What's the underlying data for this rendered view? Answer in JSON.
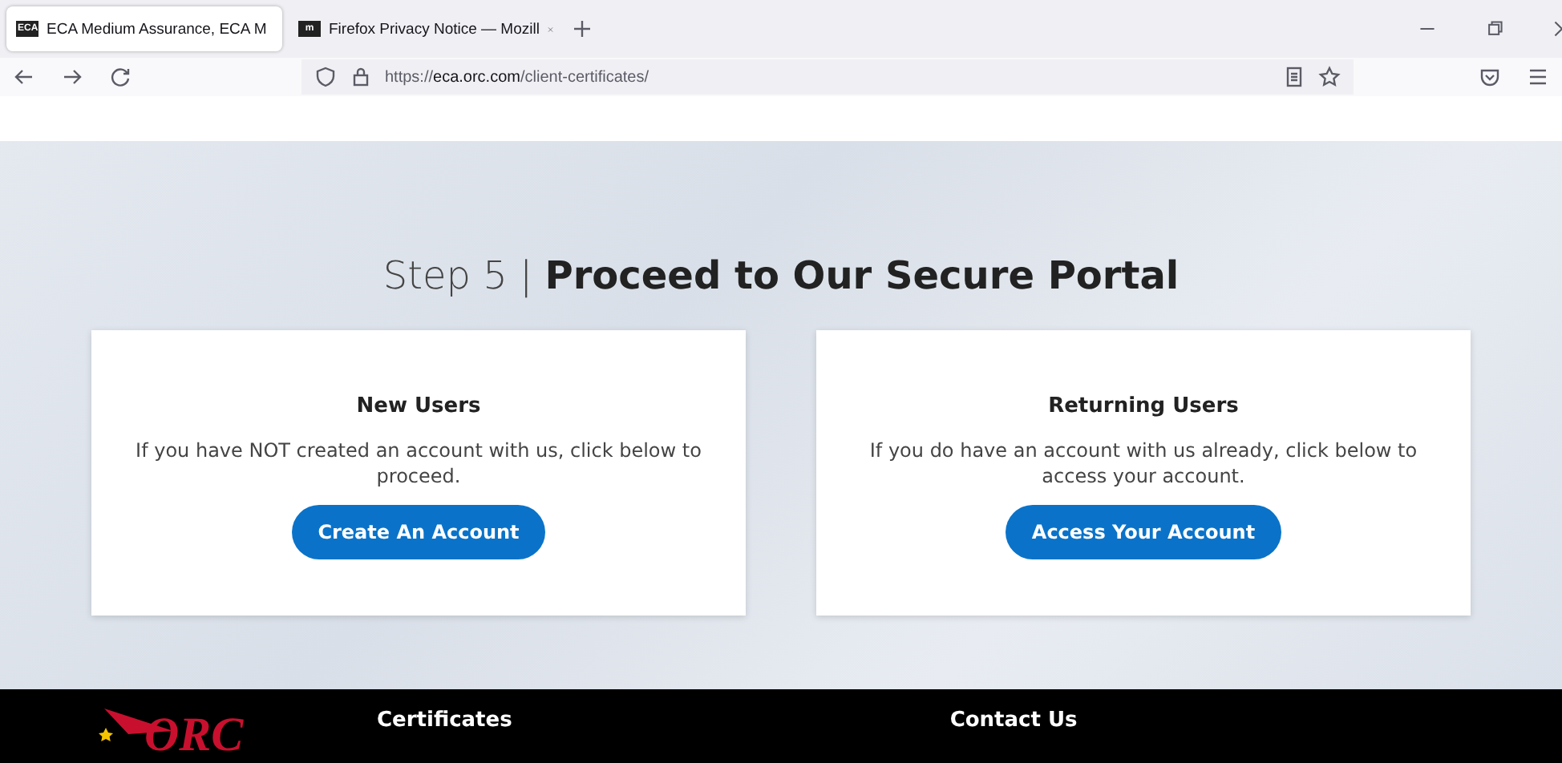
{
  "browser": {
    "tabs": [
      {
        "title": "ECA Medium Assurance, ECA M",
        "favicon": "ECA",
        "selected": true
      },
      {
        "title": "Firefox Privacy Notice — Mozill",
        "favicon": "m",
        "selected": false
      }
    ],
    "url": "https://**eca.orc.com**/client-certificates/"
  },
  "hero": {
    "heading": "Step 5 | **Proceed to Our Secure Portal**",
    "cards": [
      {
        "title": "New Users",
        "text": "If you have NOT created an account with us, click below to proceed.",
        "button": "Create An Account"
      },
      {
        "title": "Returning Users",
        "text": "If you do have an account with us already, click below to access your account.",
        "button": "Access Your Account"
      }
    ]
  },
  "footer": {
    "logo": "ORC",
    "columns": [
      "Certificates",
      "Contact Us"
    ]
  }
}
